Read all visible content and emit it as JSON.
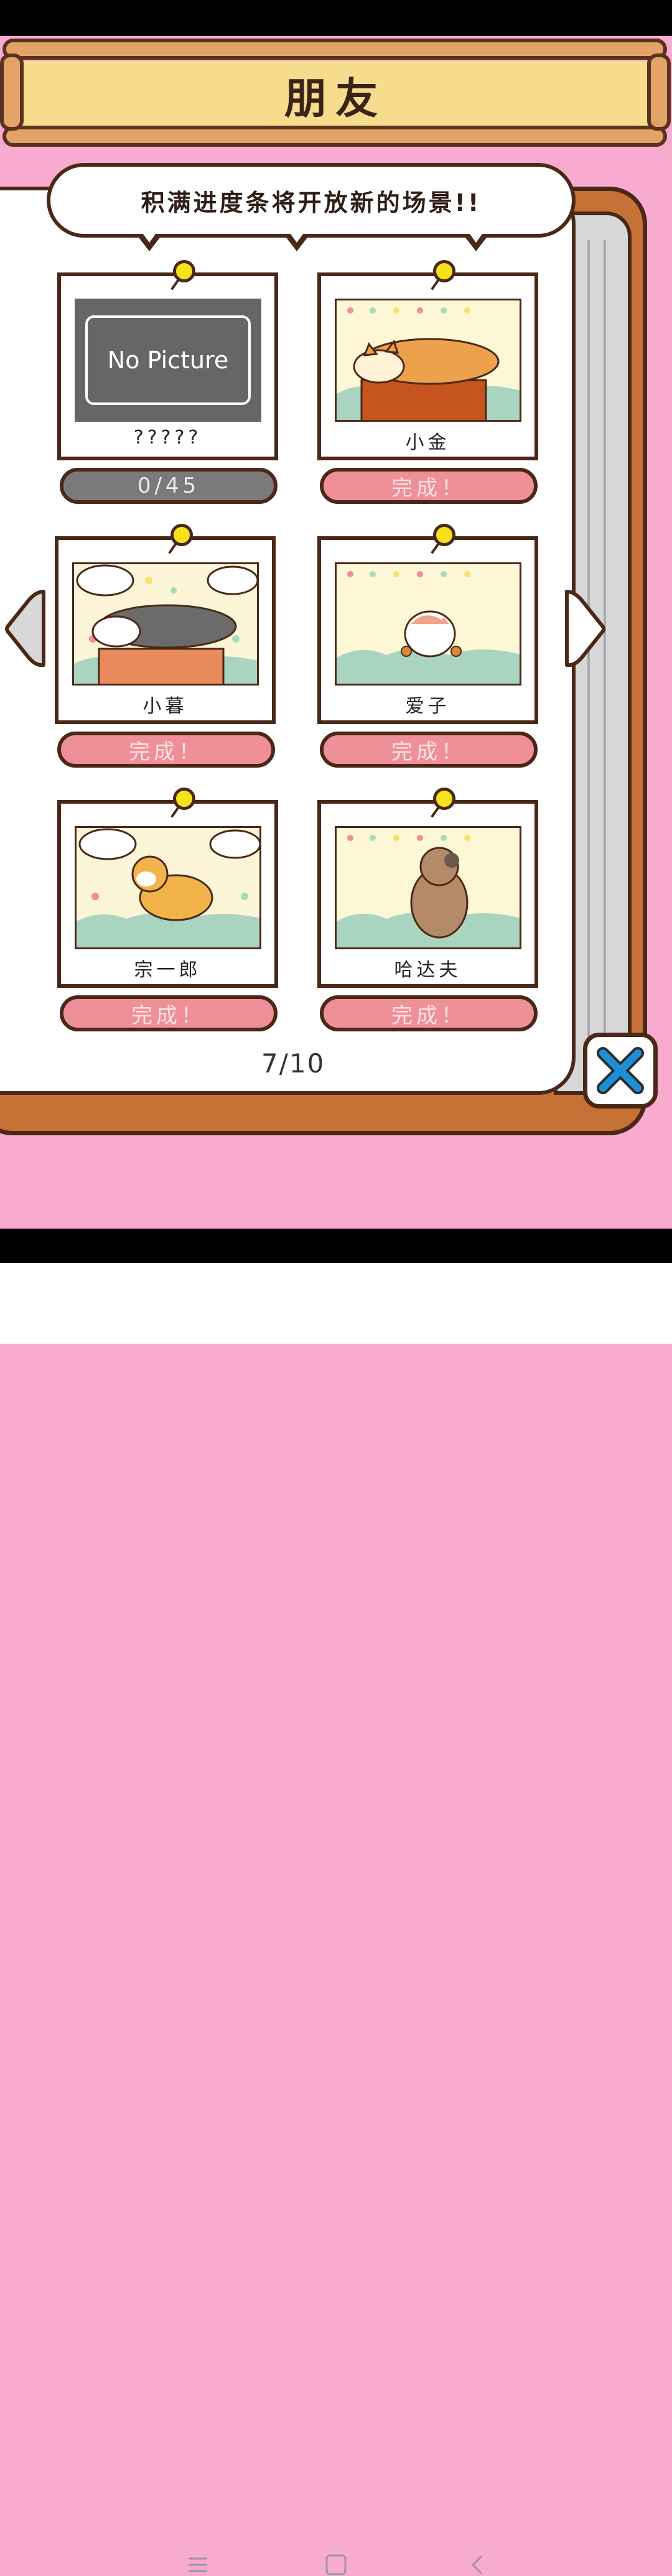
{
  "title": "朋友",
  "bubble_text": "积满进度条将开放新的场景!!",
  "friends": [
    {
      "name": "?????",
      "status": "0/45",
      "state": "locked",
      "placeholder": "No Picture"
    },
    {
      "name": "小金",
      "status": "完成！",
      "state": "done"
    },
    {
      "name": "小暮",
      "status": "完成！",
      "state": "done"
    },
    {
      "name": "爱子",
      "status": "完成！",
      "state": "done"
    },
    {
      "name": "宗一郎",
      "status": "完成！",
      "state": "done"
    },
    {
      "name": "哈达夫",
      "status": "完成！",
      "state": "done"
    }
  ],
  "page_counter": "7/10",
  "colors": {
    "background": "#f9abcf",
    "banner": "#f7dc8d",
    "wood": "#c67236",
    "done_pill": "#ef8f97",
    "close_x": "#1c8fd6"
  },
  "icons": {
    "close": "close-x-icon",
    "left": "left-arrow-icon",
    "right": "right-arrow-icon"
  },
  "nav": [
    "menu-icon",
    "home-icon",
    "back-icon"
  ]
}
